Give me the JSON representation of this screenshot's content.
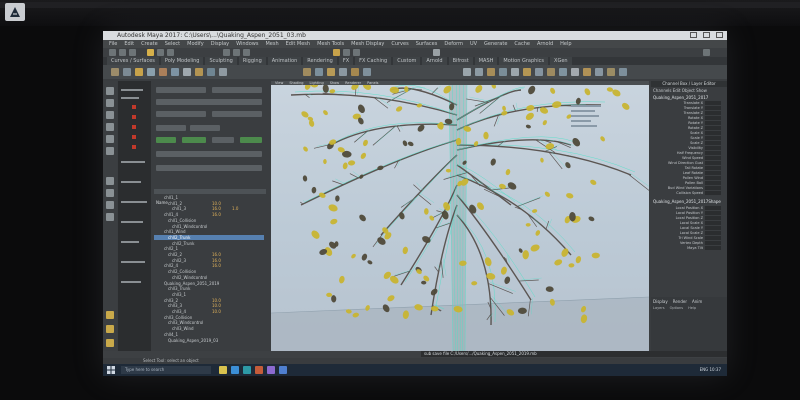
{
  "app": {
    "window_title": "Autodesk Maya 2017: C:\\Users\\...\\Quaking_Aspen_2051_03.mb"
  },
  "menubar": {
    "items": [
      "File",
      "Edit",
      "Create",
      "Select",
      "Modify",
      "Display",
      "Windows",
      "Mesh",
      "Edit Mesh",
      "Mesh Tools",
      "Mesh Display",
      "Curves",
      "Surfaces",
      "Deform",
      "UV",
      "Generate",
      "Cache",
      "Arnold",
      "Help"
    ]
  },
  "shelf": {
    "tabs": [
      "Curves / Surfaces",
      "Poly Modeling",
      "Sculpting",
      "Rigging",
      "Animation",
      "Rendering",
      "FX",
      "FX Caching",
      "Custom",
      "Arnold",
      "Bifrost",
      "MASH",
      "Motion Graphics",
      "XGen"
    ]
  },
  "viewport": {
    "menu": [
      "View",
      "Shading",
      "Lighting",
      "Show",
      "Renderer",
      "Panels"
    ]
  },
  "attribute_editor": {
    "node_label": "Name"
  },
  "outliner": {
    "rows": [
      {
        "label": "chll1_1",
        "v1": "",
        "v2": "",
        "selected": false
      },
      {
        "label": "chll1_2",
        "v1": "10.0",
        "v2": "",
        "selected": false
      },
      {
        "label": "chll1_3",
        "v1": "16.0",
        "v2": "1.0",
        "selected": false
      },
      {
        "label": "chll1_4",
        "v1": "16.0",
        "v2": "",
        "selected": false
      },
      {
        "label": "chll1_Collision",
        "v1": "",
        "v2": "",
        "selected": false
      },
      {
        "label": "chll1_Windcontrol",
        "v1": "",
        "v2": "",
        "selected": false
      },
      {
        "label": "chll1_Wind",
        "v1": "",
        "v2": "",
        "selected": false
      },
      {
        "label": "chll2_Trunk",
        "v1": "",
        "v2": "",
        "selected": true
      },
      {
        "label": "chll2_Trunk",
        "v1": "",
        "v2": "",
        "selected": false
      },
      {
        "label": "chll2_1",
        "v1": "",
        "v2": "",
        "selected": false
      },
      {
        "label": "chll2_2",
        "v1": "16.0",
        "v2": "",
        "selected": false
      },
      {
        "label": "chll2_3",
        "v1": "16.0",
        "v2": "",
        "selected": false
      },
      {
        "label": "chll2_4",
        "v1": "16.0",
        "v2": "",
        "selected": false
      },
      {
        "label": "chll2_Collision",
        "v1": "",
        "v2": "",
        "selected": false
      },
      {
        "label": "chll2_Windcontrol",
        "v1": "",
        "v2": "",
        "selected": false
      },
      {
        "label": "Quaking_Aspen_2051_2019",
        "v1": "",
        "v2": "",
        "selected": false
      },
      {
        "label": "chll3_Trunk",
        "v1": "",
        "v2": "",
        "selected": false
      },
      {
        "label": "chll3_1",
        "v1": "",
        "v2": "",
        "selected": false
      },
      {
        "label": "chll3_2",
        "v1": "10.0",
        "v2": "",
        "selected": false
      },
      {
        "label": "chll3_3",
        "v1": "10.0",
        "v2": "",
        "selected": false
      },
      {
        "label": "chll3_4",
        "v1": "10.0",
        "v2": "",
        "selected": false
      },
      {
        "label": "chll3_Collision",
        "v1": "",
        "v2": "",
        "selected": false
      },
      {
        "label": "chll3_Windcontrol",
        "v1": "",
        "v2": "",
        "selected": false
      },
      {
        "label": "chll3_Wind",
        "v1": "",
        "v2": "",
        "selected": false
      },
      {
        "label": "chll4_1",
        "v1": "",
        "v2": "",
        "selected": false
      },
      {
        "label": "Quaking_Aspen_2019_03",
        "v1": "",
        "v2": "",
        "selected": false
      }
    ]
  },
  "channel_box": {
    "title": "Channel Box / Layer Editor",
    "tabs": "Channels  Edit  Object  Show",
    "node1": "Quaking_Aspen_2051_2017",
    "attrs1": [
      "Translate X",
      "Translate Y",
      "Translate Z",
      "Rotate X",
      "Rotate Y",
      "Rotate Z",
      "Scale X",
      "Scale Y",
      "Scale Z",
      "Visibility",
      "Half Frequency",
      "Wind Speed",
      "Wind Direction Gust",
      "Tail Rotate",
      "Leaf Rotate",
      "Pollen Wind",
      "Pollen Ball",
      "Bud Wind Variations",
      "Collision Speed"
    ],
    "node2": "Quaking_Aspen_2051_2017Shape",
    "attrs2": [
      "Local Position X",
      "Local Position Y",
      "Local Position Z",
      "Local Scale X",
      "Local Scale Y",
      "Local Scale Z",
      "Tri Wind Scale",
      "Vertex Depth",
      "Maya Tilt"
    ]
  },
  "layers": {
    "tabs": [
      "Display",
      "Render",
      "Anim"
    ],
    "menu": [
      "Layers",
      "Options",
      "Help"
    ]
  },
  "command_line": {
    "text": "sub save file C:/Users/.../Quaking_Aspen_2051_2019.mb"
  },
  "help_line": {
    "text": "Select Tool: select an object"
  },
  "taskbar": {
    "search_placeholder": "Type here to search",
    "tray_text": "ENG  10:37"
  },
  "colors": {
    "maya_ui": "#3a3d40",
    "viewport_bg": "#c9d4de",
    "wireframe": "#4fe0c8",
    "leaf": "#c8b432",
    "selection": "#5680b0"
  }
}
